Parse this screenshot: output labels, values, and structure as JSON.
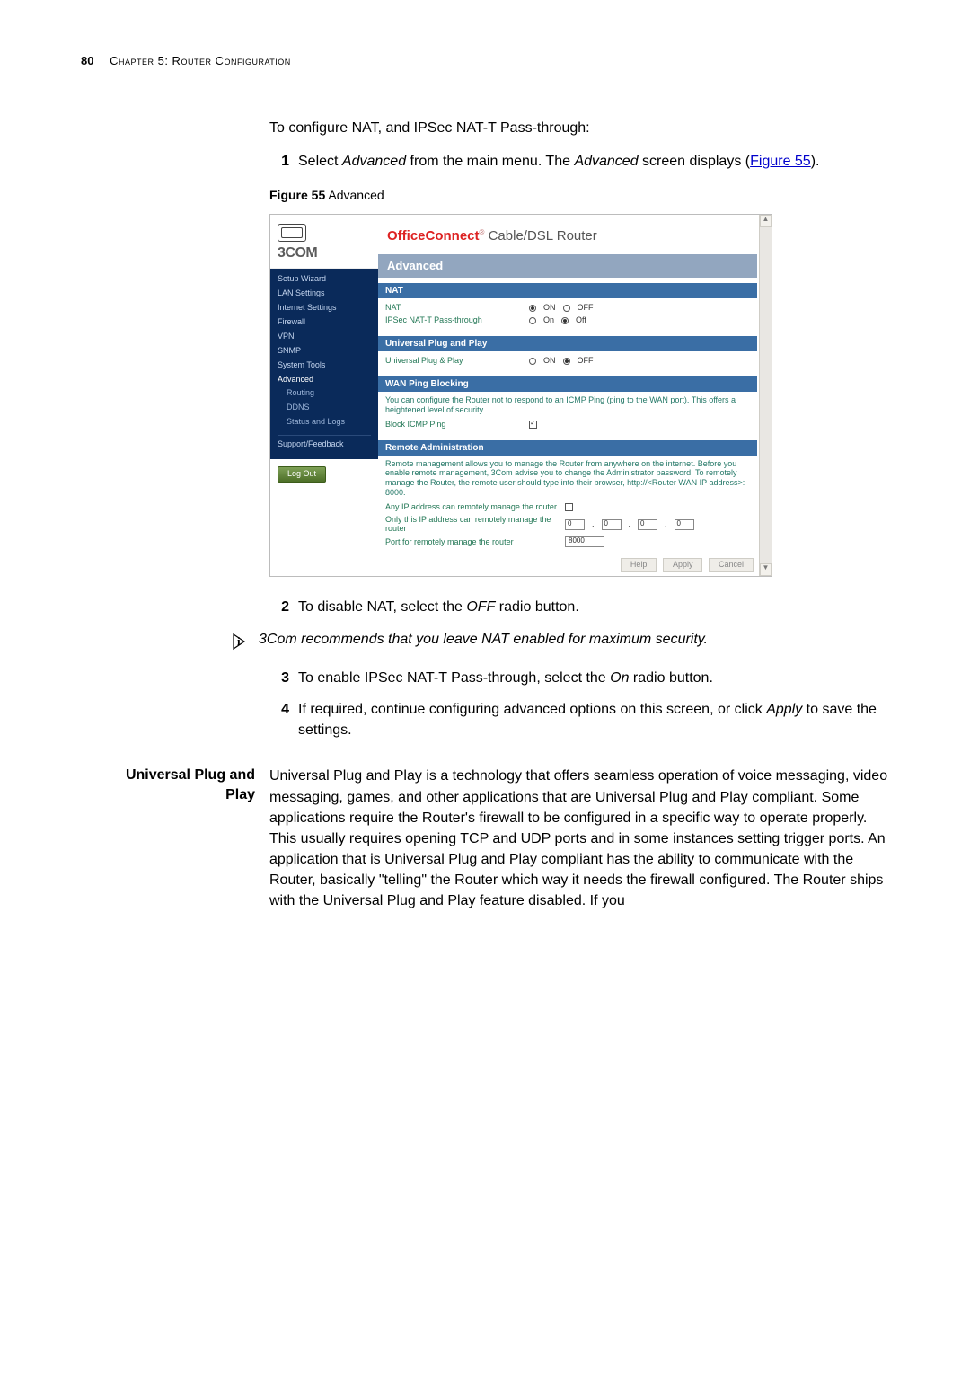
{
  "header": {
    "page": "80",
    "chapter_label": "Chapter 5: Router Configuration"
  },
  "intro_para": "To configure NAT, and IPSec NAT-T Pass-through:",
  "step1": {
    "num": "1",
    "pre": "Select ",
    "i1": "Advanced",
    "mid": " from the main menu. The ",
    "i2": "Advanced",
    "post": " screen displays (",
    "link": "Figure 55",
    "close": ")."
  },
  "fig_caption": {
    "label": "Figure 55",
    "title": "   Advanced"
  },
  "shot": {
    "logo_text": "3COM",
    "brand_bold": "OfficeConnect",
    "brand_rest": " Cable/DSL Router",
    "page_title": "Advanced",
    "sidebar": {
      "items": [
        "Setup Wizard",
        "LAN Settings",
        "Internet Settings",
        "Firewall",
        "VPN",
        "SNMP",
        "System Tools",
        "Advanced"
      ],
      "sub_items": [
        "Routing",
        "DDNS",
        "Status and Logs"
      ],
      "support": "Support/Feedback",
      "logout": "Log Out"
    },
    "nat": {
      "hdr": "NAT",
      "row1": {
        "lbl": "NAT",
        "on": "ON",
        "off": "OFF"
      },
      "row2": {
        "lbl": "IPSec NAT-T Pass-through",
        "on": "On",
        "off": "Off"
      }
    },
    "upp": {
      "hdr": "Universal Plug and Play",
      "row": {
        "lbl": "Universal Plug & Play",
        "on": "ON",
        "off": "OFF"
      }
    },
    "wan": {
      "hdr": "WAN Ping Blocking",
      "blurb": "You can configure the Router not to respond to an ICMP Ping (ping to the WAN port). This offers a heightened level of security.",
      "row": {
        "lbl": "Block ICMP Ping"
      }
    },
    "ra": {
      "hdr": "Remote Administration",
      "blurb": "Remote management allows you to manage the Router from anywhere on the internet. Before you enable remote management, 3Com advise you to change the Administrator password. To remotely manage the Router, the remote user should type into their browser, http://<Router WAN IP address>: 8000.",
      "row1": "Any IP address can remotely manage the router",
      "row2": "Only this IP address can remotely manage the router",
      "row3": "Port for remotely manage the router",
      "ip": [
        "0",
        "0",
        "0",
        "0"
      ],
      "port": "8000"
    },
    "buttons": {
      "help": "Help",
      "apply": "Apply",
      "cancel": "Cancel"
    }
  },
  "step2": {
    "num": "2",
    "pre": "To disable NAT, select the ",
    "i": "OFF",
    "post": " radio button."
  },
  "info_note": "3Com recommends that you leave NAT enabled for maximum security.",
  "step3": {
    "num": "3",
    "pre": "To enable IPSec NAT-T Pass-through, select the ",
    "i": "On",
    "post": " radio button."
  },
  "step4": {
    "num": "4",
    "pre": "If required, continue configuring advanced options on this screen, or click ",
    "i": "Apply",
    "post": " to save the settings."
  },
  "section": {
    "heading_l1": "Universal Plug and",
    "heading_l2": "Play",
    "body": "Universal Plug and Play is a technology that offers seamless operation of voice messaging, video messaging, games, and other applications that are Universal Plug and Play compliant. Some applications require the Router's firewall to be configured in a specific way to operate properly. This usually requires opening TCP and UDP ports and in some instances setting trigger ports. An application that is Universal Plug and Play compliant has the ability to communicate with the Router, basically \"telling\" the Router which way it needs the firewall configured. The Router ships with the Universal Plug and Play feature disabled. If you"
  }
}
